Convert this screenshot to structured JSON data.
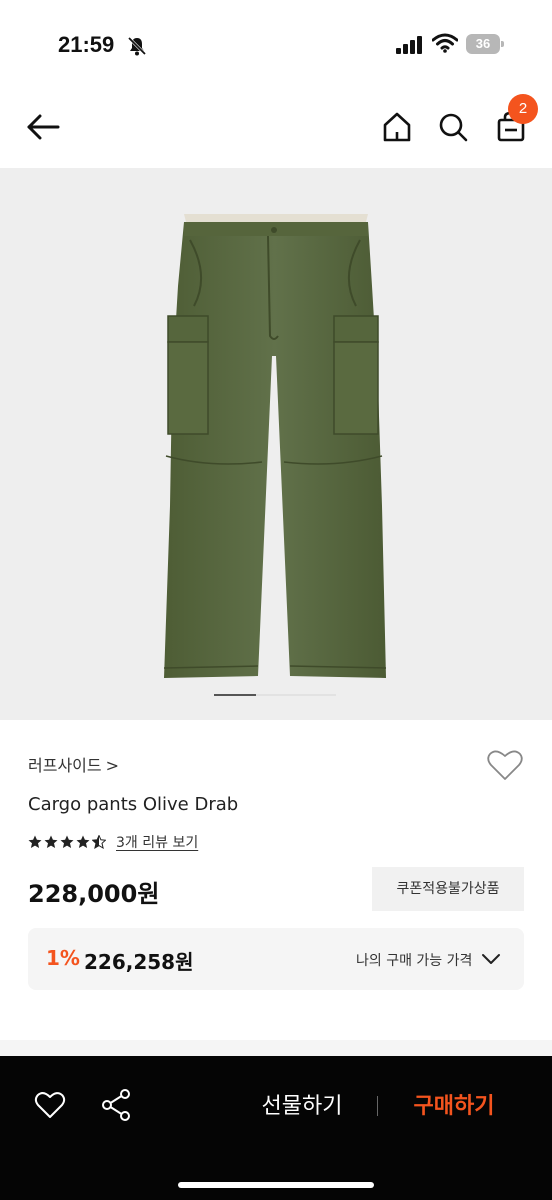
{
  "status_bar": {
    "time": "21:59",
    "battery": "36"
  },
  "nav": {
    "cart_count": "2"
  },
  "product": {
    "brand": "러프사이드",
    "brand_chevron": ">",
    "name": "Cargo pants Olive Drab",
    "rating": 4.5,
    "review_link": "3개 리뷰 보기",
    "price": "228,000원",
    "coupon_note": "쿠폰적용불가상품",
    "discount_rate": "1%",
    "discount_price": "226,258원",
    "buyable_label": "나의 구매 가능 가격"
  },
  "carousel": {
    "current": 1,
    "total": 3
  },
  "bottom": {
    "gift_label": "선물하기",
    "buy_label": "구매하기"
  },
  "colors": {
    "accent": "#f4541e",
    "pants": "#5b6a3f",
    "bar": "#050505"
  }
}
